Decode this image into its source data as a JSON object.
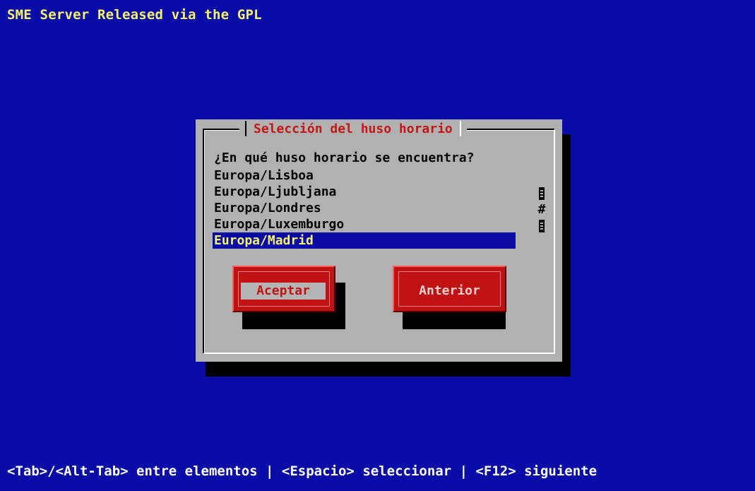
{
  "screen": {
    "title": "SME Server Released via the GPL",
    "status_bar": "<Tab>/<Alt-Tab> entre elementos  |  <Espacio> seleccionar  |  <F12> siguiente"
  },
  "dialog": {
    "title": "Selección del huso horario",
    "prompt": "¿En qué huso horario se encuentra?",
    "timezones": [
      "Europa/Lisboa",
      "Europa/Ljubljana",
      "Europa/Londres",
      "Europa/Luxemburgo",
      "Europa/Madrid"
    ],
    "selected_timezone": "Europa/Madrid",
    "scrollbar": {
      "thumb_glyph": "#"
    },
    "buttons": {
      "accept_label": "Aceptar",
      "previous_label": "Anterior"
    }
  },
  "colors": {
    "background": "#0a0ca8",
    "dialog": "#b1b1b1",
    "title_text": "#c51616",
    "highlight_bg": "#0b0ca6",
    "highlight_text": "#f5f36a",
    "button": "#c01212"
  }
}
